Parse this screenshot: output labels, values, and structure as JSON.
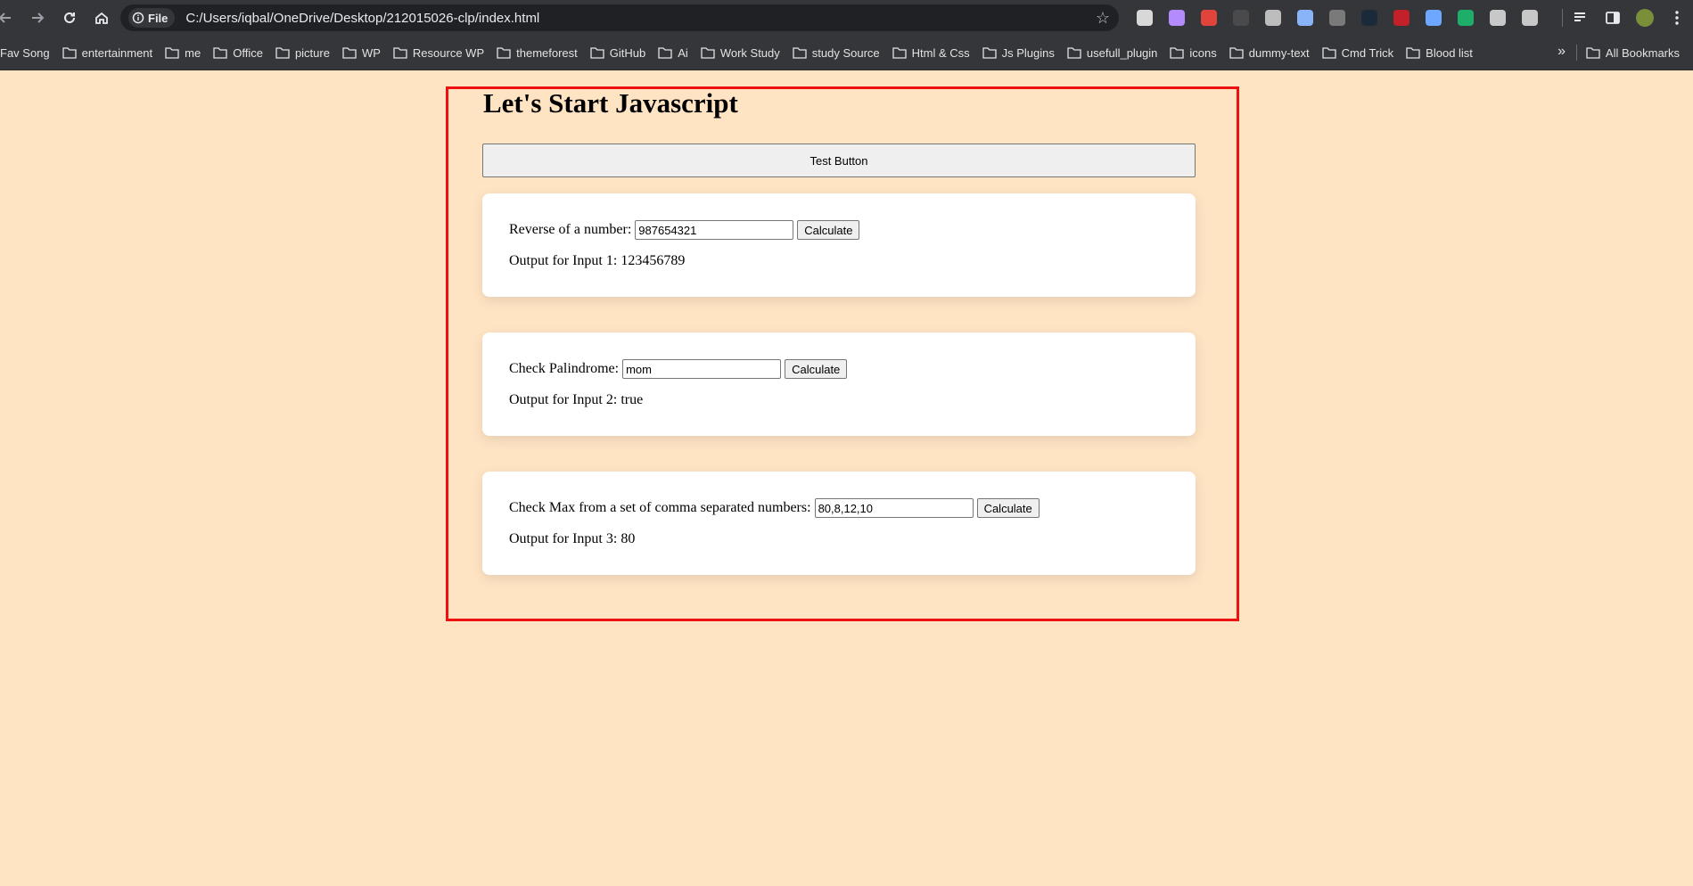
{
  "browser": {
    "site_chip": "File",
    "url": "C:/Users/iqbal/OneDrive/Desktop/212015026-clp/index.html",
    "bookmarks": [
      "Fav Song",
      "entertainment",
      "me",
      "Office",
      "picture",
      "WP",
      "Resource WP",
      "themeforest",
      "GitHub",
      "Ai",
      "Work Study",
      "study Source",
      "Html & Css",
      "Js Plugins",
      "usefull_plugin",
      "icons",
      "dummy-text",
      "Cmd Trick",
      "Blood list"
    ],
    "all_bookmarks": "All Bookmarks",
    "overflow": "»",
    "extensions": [
      {
        "name": "font-icon",
        "color": "#d8d8d8"
      },
      {
        "name": "feather-icon",
        "color": "#b38bff"
      },
      {
        "name": "color-wheel-icon",
        "color": "#e0443a"
      },
      {
        "name": "dark-ext-icon",
        "color": "#4a4a4c"
      },
      {
        "name": "camera-icon",
        "color": "#bdbdbd"
      },
      {
        "name": "screen-capture-icon",
        "color": "#8ab4f8"
      },
      {
        "name": "ruler-icon",
        "color": "#7a7a7a"
      },
      {
        "name": "dark-reader-icon",
        "color": "#1b2a3a"
      },
      {
        "name": "ublock-icon",
        "color": "#c4202a"
      },
      {
        "name": "screenshot-icon",
        "color": "#6da7ff"
      },
      {
        "name": "grammarly-icon",
        "color": "#1fae6a"
      },
      {
        "name": "globe-icon",
        "color": "#c8c8c8"
      },
      {
        "name": "extensions-puzzle-icon",
        "color": "#c8c8c8"
      }
    ]
  },
  "page": {
    "title": "Let's Start Javascript",
    "test_button": "Test Button",
    "cards": [
      {
        "label": "Reverse of a number:",
        "value": "987654321",
        "button": "Calculate",
        "output": "Output for Input 1: 123456789"
      },
      {
        "label": "Check Palindrome:",
        "value": "mom",
        "button": "Calculate",
        "output": "Output for Input 2: true"
      },
      {
        "label": "Check Max from a set of comma separated numbers:",
        "value": "80,8,12,10",
        "button": "Calculate",
        "output": "Output for Input 3: 80"
      }
    ]
  }
}
